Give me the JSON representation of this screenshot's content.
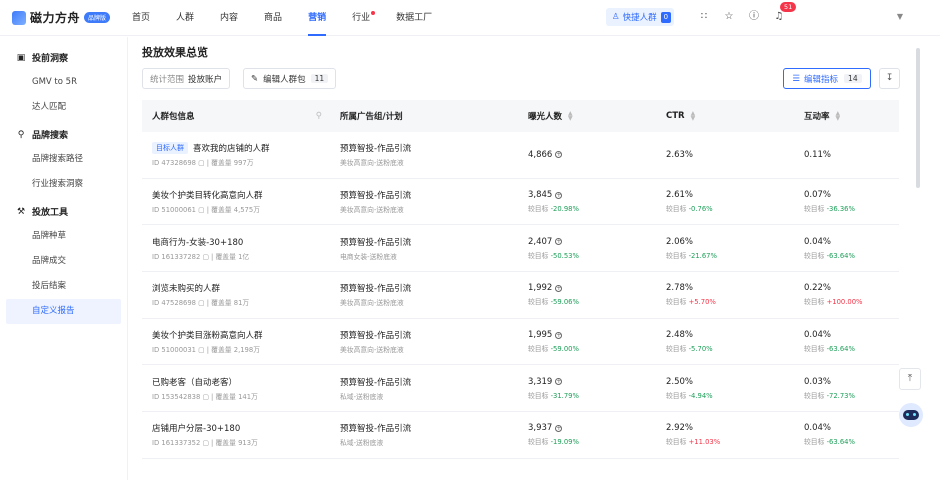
{
  "app": {
    "logo_text": "磁力方舟",
    "logo_badge": "品牌版"
  },
  "nav": [
    "首页",
    "人群",
    "内容",
    "商品",
    "营销",
    "行业",
    "数据工厂"
  ],
  "nav_active": "营销",
  "quick_crowd": {
    "label": "快捷人群",
    "count": "0"
  },
  "notifications_count": "51",
  "sidebar": {
    "groups": [
      {
        "label": "投前洞察",
        "icon": "chart-icon",
        "items": [
          "GMV to 5R",
          "达人匹配"
        ]
      },
      {
        "label": "品牌搜索",
        "icon": "search-icon",
        "items": [
          "品牌搜索路径",
          "行业搜索洞察"
        ]
      },
      {
        "label": "投放工具",
        "icon": "tool-icon",
        "items": [
          "品牌种草",
          "品牌成交",
          "投后结案",
          "自定义报告"
        ]
      }
    ],
    "active_item": "自定义报告"
  },
  "page": {
    "title": "投放效果总览",
    "filter": {
      "label": "统计范围",
      "value": "投放账户"
    },
    "edit_crowd": {
      "label": "编辑人群包",
      "count": "11"
    },
    "edit_metrics": {
      "label": "编辑指标",
      "count": "14"
    }
  },
  "table": {
    "headers": [
      "人群包信息",
      "所属广告组/计划",
      "曝光人数",
      "CTR",
      "互动率"
    ],
    "rows": [
      {
        "tag": "目标人群",
        "name": "喜欢我的店铺的人群",
        "sub": "ID 47328698 ▢ | 覆盖量 997万",
        "plan": "预算智投-作品引流",
        "plan_sub": "美妆高意向-送粉底液",
        "exposure": "4,866",
        "exposure_cmp": "",
        "ctr": "2.63%",
        "ctr_cmp": "",
        "interact": "0.11%",
        "interact_cmp": ""
      },
      {
        "tag": "",
        "name": "美妆个护类目转化高意向人群",
        "sub": "ID 51000061 ▢ | 覆盖量 4,575万",
        "plan": "预算智投-作品引流",
        "plan_sub": "美妆高意向-送粉底液",
        "exposure": "3,845",
        "exposure_cmp": "较目标 -20.98%",
        "ctr": "2.61%",
        "ctr_cmp": "较目标 -0.76%",
        "interact": "0.07%",
        "interact_cmp": "较目标 -36.36%"
      },
      {
        "tag": "",
        "name": "电商行为-女装-30+180",
        "sub": "ID 161337282 ▢ | 覆盖量 1亿",
        "plan": "预算智投-作品引流",
        "plan_sub": "电商女装-送粉底液",
        "exposure": "2,407",
        "exposure_cmp": "较目标 -50.53%",
        "ctr": "2.06%",
        "ctr_cmp": "较目标 -21.67%",
        "interact": "0.04%",
        "interact_cmp": "较目标 -63.64%"
      },
      {
        "tag": "",
        "name": "浏览未购买的人群",
        "sub": "ID 47528698 ▢ | 覆盖量 81万",
        "plan": "预算智投-作品引流",
        "plan_sub": "美妆高意向-送粉底液",
        "exposure": "1,992",
        "exposure_cmp": "较目标 -59.06%",
        "ctr": "2.78%",
        "ctr_cmp": "较目标 +5.70%",
        "interact": "0.22%",
        "interact_cmp": "较目标 +100.00%"
      },
      {
        "tag": "",
        "name": "美妆个护类目涨粉高意向人群",
        "sub": "ID 51000031 ▢ | 覆盖量 2,198万",
        "plan": "预算智投-作品引流",
        "plan_sub": "美妆高意向-送粉底液",
        "exposure": "1,995",
        "exposure_cmp": "较目标 -59.00%",
        "ctr": "2.48%",
        "ctr_cmp": "较目标 -5.70%",
        "interact": "0.04%",
        "interact_cmp": "较目标 -63.64%"
      },
      {
        "tag": "",
        "name": "已购老客（自动老客）",
        "sub": "ID 153542838 ▢ | 覆盖量 141万",
        "plan": "预算智投-作品引流",
        "plan_sub": "私域-送粉底液",
        "exposure": "3,319",
        "exposure_cmp": "较目标 -31.79%",
        "ctr": "2.50%",
        "ctr_cmp": "较目标 -4.94%",
        "interact": "0.03%",
        "interact_cmp": "较目标 -72.73%"
      },
      {
        "tag": "",
        "name": "店铺用户分层-30+180",
        "sub": "ID 161337352 ▢ | 覆盖量 913万",
        "plan": "预算智投-作品引流",
        "plan_sub": "私域-送粉底液",
        "exposure": "3,937",
        "exposure_cmp": "较目标 -19.09%",
        "ctr": "2.92%",
        "ctr_cmp": "较目标 +11.03%",
        "interact": "0.04%",
        "interact_cmp": "较目标 -63.64%"
      }
    ]
  },
  "colors": {
    "accent": "#2f6bff",
    "positive": "#f5364a",
    "negative": "#1fa05a"
  }
}
